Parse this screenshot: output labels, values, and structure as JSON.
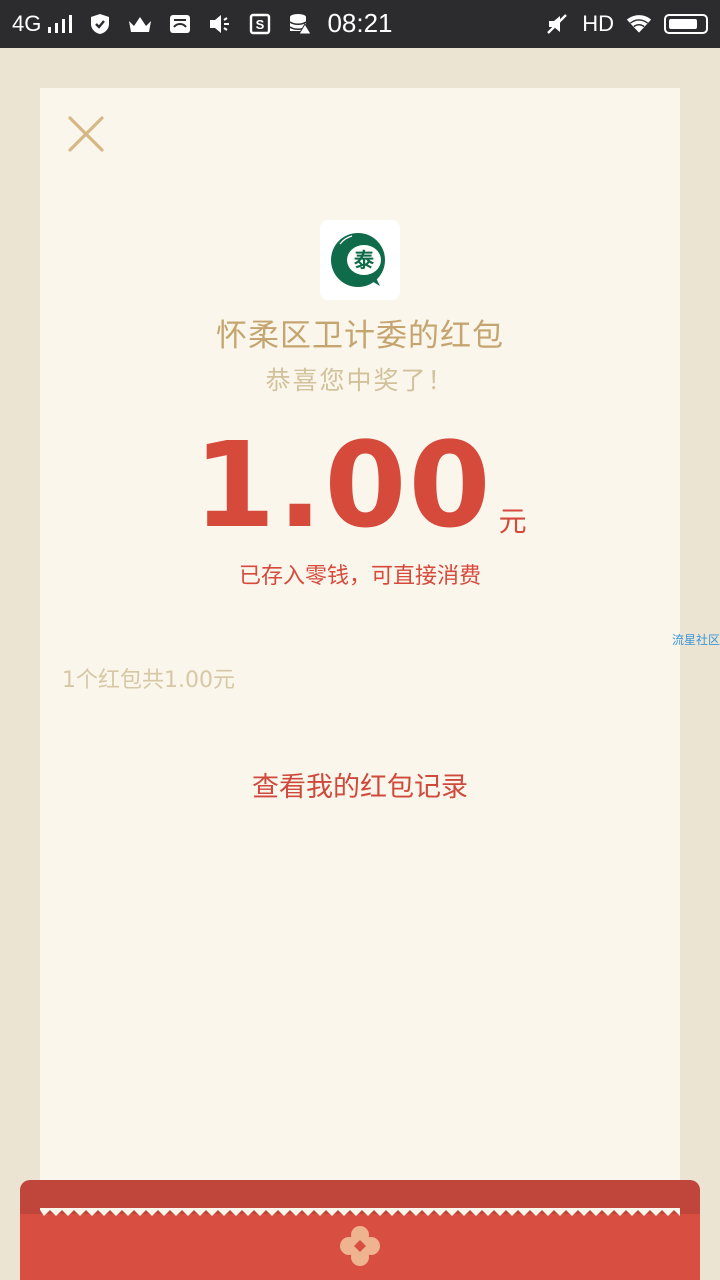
{
  "status_bar": {
    "network": "4G",
    "time": "08:21",
    "hd": "HD"
  },
  "redpacket": {
    "sender": "怀柔区卫计委的红包",
    "wish": "恭喜您中奖了！",
    "amount": "1.00",
    "unit": "元",
    "saved_text": "已存入零钱，可直接消费",
    "summary": "1个红包共1.00元",
    "records_link": "查看我的红包记录",
    "watermark": "流星社区"
  },
  "logo_text": "泰",
  "colors": {
    "accent_red": "#d64a3c",
    "gold": "#c5a56f",
    "card_bg": "#faf6ec",
    "page_bg": "#ece4d3",
    "logo_green": "#0f6b4a"
  }
}
